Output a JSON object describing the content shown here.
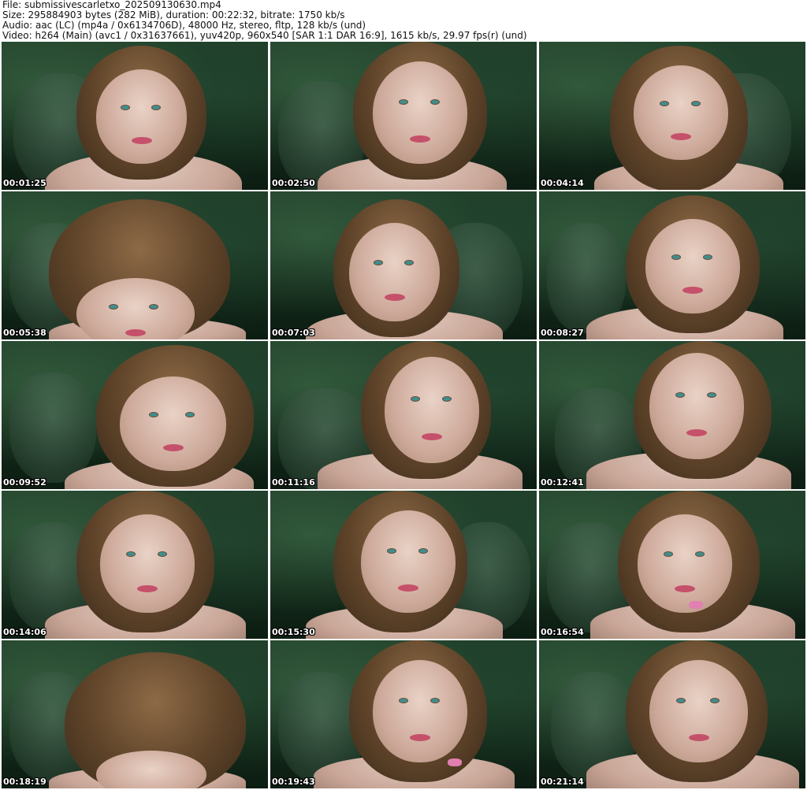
{
  "header": {
    "file": "File: submissivescarletxo_202509130630.mp4",
    "size": "Size: 295884903 bytes (282 MiB), duration: 00:22:32, bitrate: 1750 kb/s",
    "audio": "Audio: aac (LC) (mp4a / 0x6134706D), 48000 Hz, stereo, fltp, 128 kb/s (und)",
    "video": "Video: h264 (Main) (avc1 / 0x31637661), yuv420p, 960x540 [SAR 1:1 DAR 16:9], 1615 kb/s, 29.97 fps(r) (und)"
  },
  "thumbnails": [
    {
      "timestamp": "00:01:25"
    },
    {
      "timestamp": "00:02:50"
    },
    {
      "timestamp": "00:04:14"
    },
    {
      "timestamp": "00:05:38"
    },
    {
      "timestamp": "00:07:03"
    },
    {
      "timestamp": "00:08:27"
    },
    {
      "timestamp": "00:09:52"
    },
    {
      "timestamp": "00:11:16"
    },
    {
      "timestamp": "00:12:41"
    },
    {
      "timestamp": "00:14:06"
    },
    {
      "timestamp": "00:15:30"
    },
    {
      "timestamp": "00:16:54"
    },
    {
      "timestamp": "00:18:19"
    },
    {
      "timestamp": "00:19:43"
    },
    {
      "timestamp": "00:21:14"
    }
  ],
  "colors": {
    "background": "#ffffff",
    "header_text": "#111111",
    "timestamp_text": "#ffffff",
    "backdrop_green": "#1f3d28",
    "hair_brown": "#8d6a46",
    "skin": "#e9d2c6",
    "eye_teal": "#3e8f8c",
    "lip_pink": "#c5506a"
  }
}
